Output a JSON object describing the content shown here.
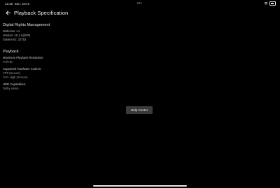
{
  "status_bar": {
    "time": "12:32",
    "date": "Sun, Oct 6",
    "center_dots": "•••",
    "wifi_icon": "wifi-icon",
    "battery_icon": "battery-icon"
  },
  "header": {
    "back_icon": "arrow-left-icon",
    "title": "Playback Specification"
  },
  "drm": {
    "title": "Digital Rights Management",
    "widevine": "Widevine: L1",
    "version": "Version: 16.1.1@006",
    "system_id": "System ID: 22753"
  },
  "playback": {
    "title": "Playback",
    "max_resolution_label": "Maximum Playback Resolution:",
    "max_resolution_value": "Full HD",
    "codecs_label": "Supported Hardware Codecs:",
    "codecs": [
      "VP9 (Secure)",
      "AVC-High (Secure)"
    ],
    "hdr_label": "HDR Capabilities:",
    "hdr_value": "Dolby vision"
  },
  "help_button_label": "Help Center"
}
